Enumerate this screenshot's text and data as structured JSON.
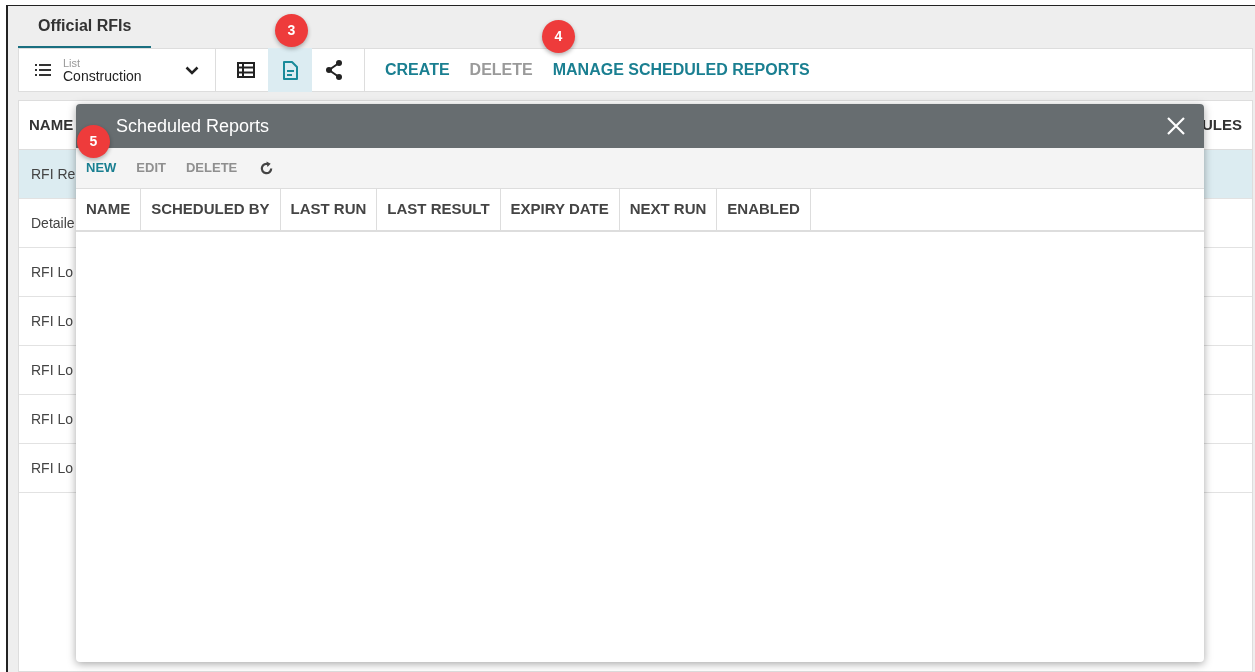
{
  "tab": {
    "label": "Official RFIs",
    "selected": true
  },
  "view_selector": {
    "label": "List",
    "value": "Construction"
  },
  "view_buttons": [
    {
      "kind": "table",
      "selected": false
    },
    {
      "kind": "document",
      "selected": true
    },
    {
      "kind": "share",
      "selected": false
    }
  ],
  "actions": [
    {
      "label": "CREATE",
      "disabled": false
    },
    {
      "label": "DELETE",
      "disabled": true
    },
    {
      "label": "MANAGE SCHEDULED REPORTS",
      "disabled": false
    }
  ],
  "table": {
    "columns": [
      "NAME",
      "ULES"
    ],
    "rows": [
      {
        "name": "RFI Re",
        "selected": true
      },
      {
        "name": "Detaile",
        "selected": false
      },
      {
        "name": "RFI Lo",
        "selected": false
      },
      {
        "name": "RFI Lo",
        "selected": false
      },
      {
        "name": "RFI Lo",
        "selected": false
      },
      {
        "name": "RFI Lo",
        "selected": false
      },
      {
        "name": "RFI Lo",
        "selected": false
      }
    ]
  },
  "dialog": {
    "title": "Scheduled Reports",
    "actions": [
      {
        "label": "NEW",
        "disabled": false
      },
      {
        "label": "EDIT",
        "disabled": true
      },
      {
        "label": "DELETE",
        "disabled": true
      }
    ],
    "columns": [
      "NAME",
      "SCHEDULED BY",
      "LAST RUN",
      "LAST RESULT",
      "EXPIRY DATE",
      "NEXT RUN",
      "ENABLED"
    ]
  },
  "callouts": [
    "3",
    "4",
    "5"
  ]
}
